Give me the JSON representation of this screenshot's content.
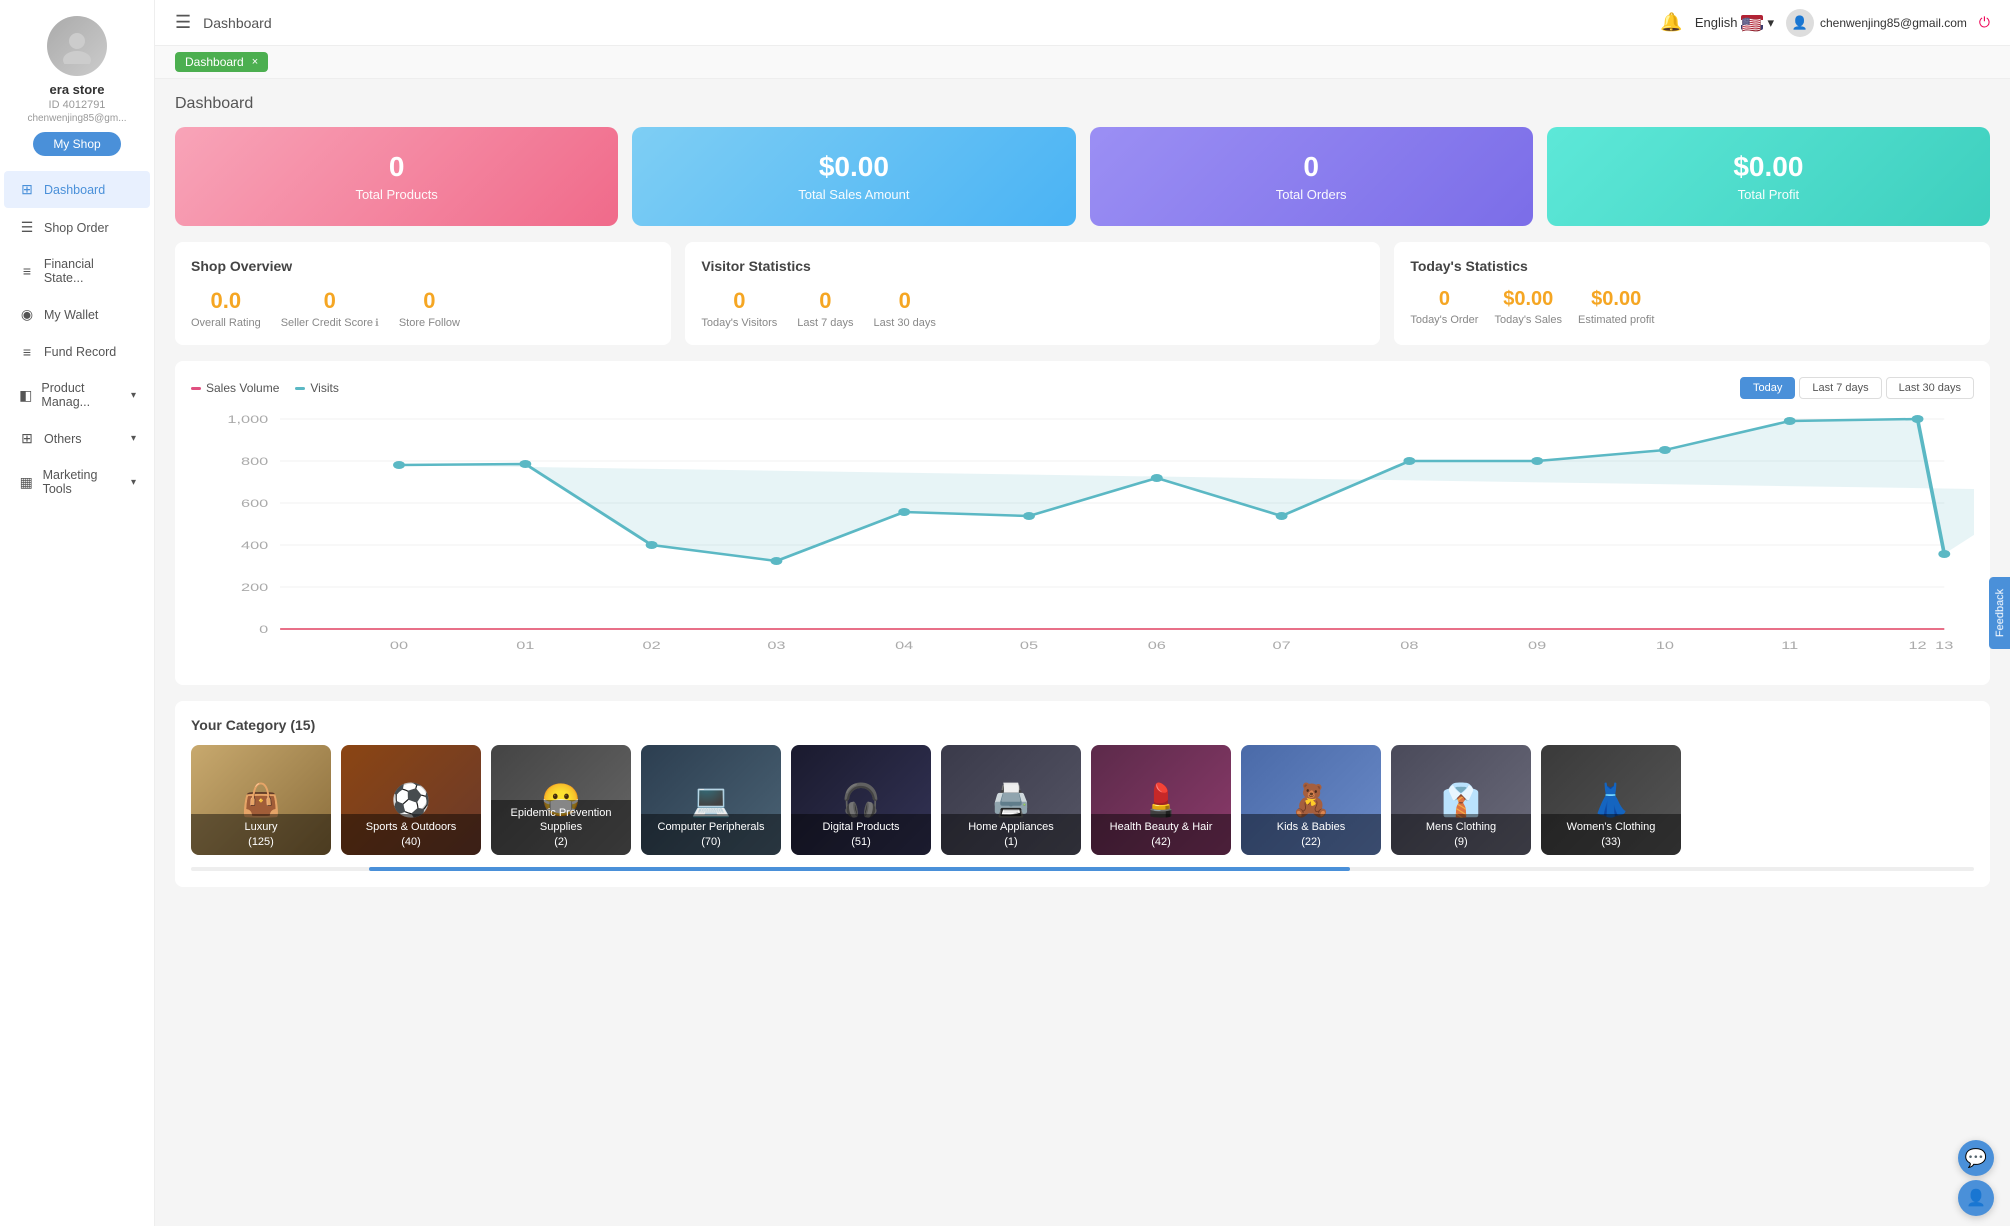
{
  "sidebar": {
    "avatar_icon": "👤",
    "store_name": "era store",
    "store_id": "ID 4012791",
    "store_email": "chenwenjing85@gm...",
    "myshop_label": "My Shop",
    "nav_items": [
      {
        "id": "dashboard",
        "label": "Dashboard",
        "icon": "⊞",
        "active": true,
        "has_sub": false
      },
      {
        "id": "shop-order",
        "label": "Shop Order",
        "icon": "☰",
        "active": false,
        "has_sub": false
      },
      {
        "id": "financial-state",
        "label": "Financial State...",
        "icon": "≡",
        "active": false,
        "has_sub": false
      },
      {
        "id": "my-wallet",
        "label": "My Wallet",
        "icon": "◉",
        "active": false,
        "has_sub": false
      },
      {
        "id": "fund-record",
        "label": "Fund Record",
        "icon": "≡",
        "active": false,
        "has_sub": false
      },
      {
        "id": "product-manage",
        "label": "Product Manag...",
        "icon": "◧",
        "active": false,
        "has_sub": true
      },
      {
        "id": "others",
        "label": "Others",
        "icon": "⊞",
        "active": false,
        "has_sub": true
      },
      {
        "id": "marketing-tools",
        "label": "Marketing Tools",
        "icon": "▦",
        "active": false,
        "has_sub": true
      }
    ]
  },
  "header": {
    "menu_icon": "☰",
    "title": "Dashboard",
    "lang": "English",
    "user_email": "chenwenjing85@gmail.com",
    "bell_icon": "🔔"
  },
  "breadcrumb": {
    "label": "Dashboard",
    "close_icon": "×"
  },
  "dashboard": {
    "title": "Dashboard"
  },
  "stats_cards": [
    {
      "id": "total-products",
      "value": "0",
      "label": "Total Products",
      "style": "pink"
    },
    {
      "id": "total-sales",
      "value": "$0.00",
      "label": "Total Sales Amount",
      "style": "blue"
    },
    {
      "id": "total-orders",
      "value": "0",
      "label": "Total Orders",
      "style": "purple"
    },
    {
      "id": "total-profit",
      "value": "$0.00",
      "label": "Total Profit",
      "style": "teal"
    }
  ],
  "shop_overview": {
    "title": "Shop Overview",
    "overall_rating_value": "0.0",
    "overall_rating_label": "Overall Rating",
    "seller_credit_value": "0",
    "seller_credit_label": "Seller Credit Score",
    "store_follow_value": "0",
    "store_follow_label": "Store Follow"
  },
  "visitor_statistics": {
    "title": "Visitor Statistics",
    "today_value": "0",
    "today_label": "Today's Visitors",
    "last7_value": "0",
    "last7_label": "Last 7 days",
    "last30_value": "0",
    "last30_label": "Last 30 days"
  },
  "todays_statistics": {
    "title": "Today's Statistics",
    "order_value": "0",
    "order_label": "Today's Order",
    "sales_value": "$0.00",
    "sales_label": "Today's Sales",
    "profit_value": "$0.00",
    "profit_label": "Estimated profit"
  },
  "chart": {
    "legend_sales": "Sales Volume",
    "legend_visits": "Visits",
    "btn_today": "Today",
    "btn_last7": "Last 7 days",
    "btn_last30": "Last 30 days",
    "x_labels": [
      "00",
      "01",
      "02",
      "03",
      "04",
      "05",
      "06",
      "07",
      "08",
      "09",
      "10",
      "11",
      "12",
      "13"
    ],
    "y_labels": [
      "0",
      "200",
      "400",
      "600",
      "800",
      "1,000"
    ],
    "data_points": [
      800,
      810,
      400,
      330,
      480,
      470,
      650,
      470,
      820,
      820,
      870,
      1030,
      1060,
      270,
      640
    ]
  },
  "category": {
    "title": "Your Category",
    "count": "15",
    "items": [
      {
        "id": "luxury",
        "name": "Luxury",
        "count": "125",
        "style": "cat-luxury",
        "icon": "👜"
      },
      {
        "id": "sports-outdoors",
        "name": "Sports & Outdoors",
        "count": "40",
        "style": "cat-sports",
        "icon": "⚽"
      },
      {
        "id": "epidemic-prevention",
        "name": "Epidemic Prevention Supplies",
        "count": "2",
        "style": "cat-epidemic",
        "icon": "😷"
      },
      {
        "id": "computer-peripherals",
        "name": "Computer Peripherals",
        "count": "70",
        "style": "cat-computer",
        "icon": "💻"
      },
      {
        "id": "digital-products",
        "name": "Digital Products",
        "count": "51",
        "style": "cat-digital",
        "icon": "🎧"
      },
      {
        "id": "home-appliances",
        "name": "Home Appliances",
        "count": "1",
        "style": "cat-home",
        "icon": "🖨️"
      },
      {
        "id": "health-beauty",
        "name": "Health Beauty & Hair",
        "count": "42",
        "style": "cat-health",
        "icon": "💄"
      },
      {
        "id": "kids-babies",
        "name": "Kids & Babies",
        "count": "22",
        "style": "cat-kids",
        "icon": "🧸"
      },
      {
        "id": "mens-clothing",
        "name": "Mens Clothing",
        "count": "9",
        "style": "cat-mens",
        "icon": "👔"
      },
      {
        "id": "womens-clothing",
        "name": "Women's Clothing",
        "count": "33",
        "style": "cat-womens",
        "icon": "👗"
      }
    ]
  },
  "feedback_btn_label": "Feedback",
  "colors": {
    "accent": "#4a90d9",
    "orange": "#f5a623",
    "pink": "#f06a8a",
    "teal": "#3ecfbe",
    "purple": "#7b6de8",
    "blue": "#4ab3f4",
    "chart_line": "#5bb8c4",
    "chart_baseline": "#e04060"
  }
}
